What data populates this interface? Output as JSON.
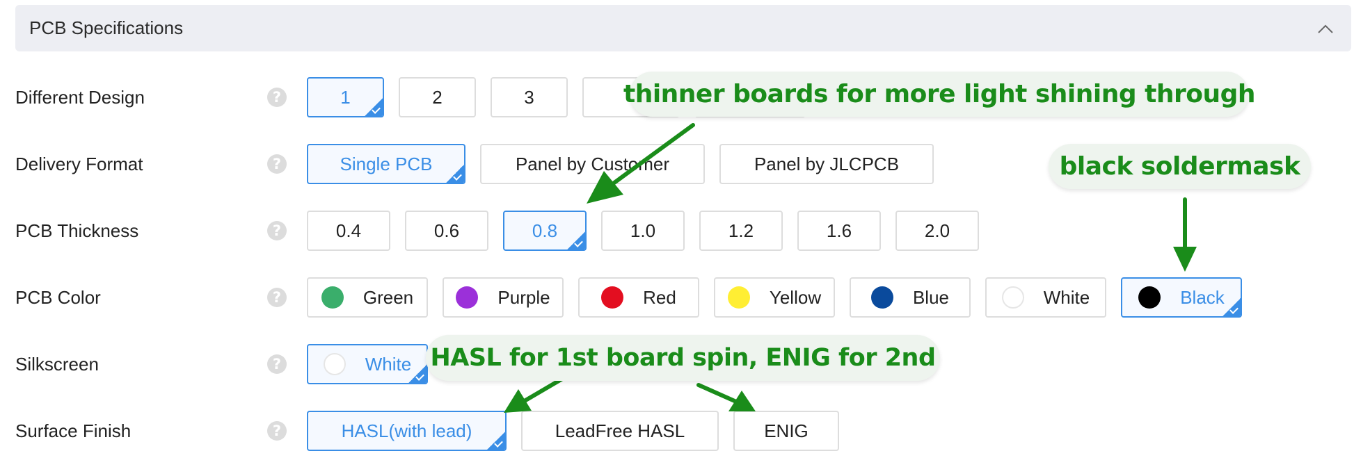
{
  "header": {
    "title": "PCB Specifications",
    "collapse_icon": "chevron-up-icon"
  },
  "rows": {
    "design": {
      "label": "Different Design",
      "help_icon": "question-circle-icon",
      "options": [
        {
          "label": "1",
          "selected": true
        },
        {
          "label": "2",
          "selected": false
        },
        {
          "label": "3",
          "selected": false
        },
        {
          "label": "",
          "selected": false
        },
        {
          "label": "",
          "selected": false
        }
      ]
    },
    "delivery": {
      "label": "Delivery Format",
      "options": [
        {
          "label": "Single PCB",
          "selected": true
        },
        {
          "label": "Panel by Customer",
          "selected": false
        },
        {
          "label": "Panel by JLCPCB",
          "selected": false
        }
      ]
    },
    "thickness": {
      "label": "PCB Thickness",
      "options": [
        {
          "label": "0.4",
          "selected": false
        },
        {
          "label": "0.6",
          "selected": false
        },
        {
          "label": "0.8",
          "selected": true
        },
        {
          "label": "1.0",
          "selected": false
        },
        {
          "label": "1.2",
          "selected": false
        },
        {
          "label": "1.6",
          "selected": false
        },
        {
          "label": "2.0",
          "selected": false
        }
      ]
    },
    "color": {
      "label": "PCB Color",
      "options": [
        {
          "label": "Green",
          "swatch": "#3aae6b",
          "selected": false
        },
        {
          "label": "Purple",
          "swatch": "#9b30d9",
          "selected": false
        },
        {
          "label": "Red",
          "swatch": "#e30e20",
          "selected": false
        },
        {
          "label": "Yellow",
          "swatch": "#ffee33",
          "selected": false
        },
        {
          "label": "Blue",
          "swatch": "#0a4a9c",
          "selected": false
        },
        {
          "label": "White",
          "swatch": "#ffffff",
          "selected": false
        },
        {
          "label": "Black",
          "swatch": "#000000",
          "selected": true
        }
      ]
    },
    "silkscreen": {
      "label": "Silkscreen",
      "options": [
        {
          "label": "White",
          "swatch": "#ffffff",
          "selected": true
        }
      ]
    },
    "surface": {
      "label": "Surface Finish",
      "options": [
        {
          "label": "HASL(with lead)",
          "selected": true
        },
        {
          "label": "LeadFree HASL",
          "selected": false
        },
        {
          "label": "ENIG",
          "selected": false
        }
      ]
    }
  },
  "annotations": {
    "thickness_note": "thinner boards for more light shining through",
    "color_note": "black soldermask",
    "finish_note": "HASL for 1st board spin, ENIG for 2nd"
  },
  "colors": {
    "accent": "#3a8ee6",
    "annotation_green": "#1a8c1a",
    "header_bg": "#edeef3"
  }
}
